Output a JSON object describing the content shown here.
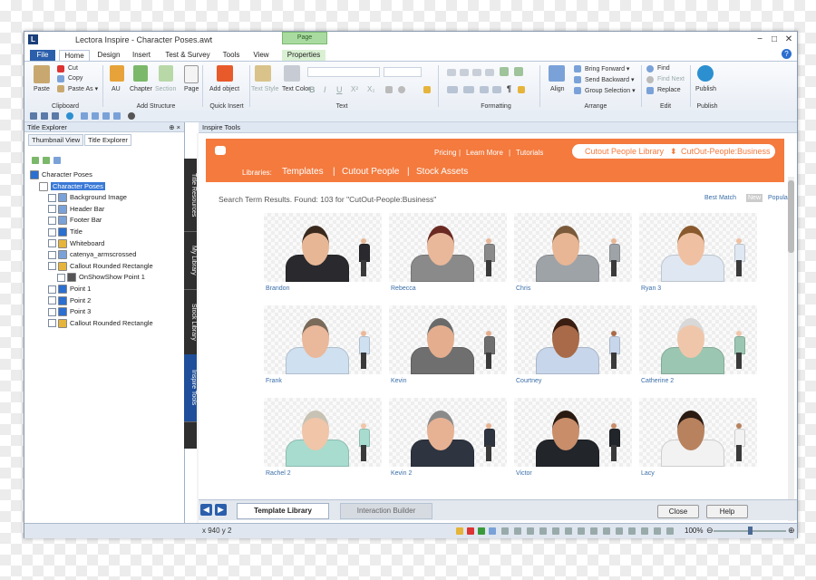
{
  "title_bar": {
    "app_logo": "L",
    "title": "Lectora Inspire - Character Poses.awt",
    "context_tab_header": "Page"
  },
  "window_controls": {
    "minimize": "−",
    "maximize": "□",
    "close": "✕"
  },
  "ribbon_tabs": [
    "File",
    "Home",
    "Design",
    "Insert",
    "Test & Survey",
    "Tools",
    "View",
    "Properties"
  ],
  "help": "?",
  "ribbon": {
    "clipboard": {
      "paste": "Paste",
      "cut": "Cut",
      "copy": "Copy",
      "paste_as": "Paste As ▾",
      "label": "Clipboard"
    },
    "add_structure": {
      "au": "AU",
      "chapter": "Chapter",
      "section": "Section",
      "page": "Page",
      "label": "Add Structure"
    },
    "quick_insert": {
      "add_object": "Add object",
      "label": "Quick Insert"
    },
    "text": {
      "text_style": "Text Style",
      "text_color": "Text Color",
      "bold": "B",
      "italic": "I",
      "underline": "U",
      "superscript": "X²",
      "subscript": "X₂",
      "label": "Text"
    },
    "formatting": {
      "pilcrow": "¶",
      "label": "Formatting"
    },
    "arrange": {
      "align": "Align",
      "bring_forward": "Bring Forward ▾",
      "send_backward": "Send Backward ▾",
      "group_selection": "Group Selection ▾",
      "label": "Arrange"
    },
    "edit": {
      "find": "Find",
      "find_next": "Find Next",
      "replace": "Replace",
      "label": "Edit"
    },
    "publish": {
      "publish": "Publish",
      "label": "Publish"
    }
  },
  "left_panel": {
    "header": "Title Explorer",
    "pin": "⊕ ×",
    "tabs": [
      "Thumbnail View",
      "Title Explorer"
    ],
    "tree": [
      {
        "label": "Character Poses",
        "indent": 0,
        "color": "#2b6fd0"
      },
      {
        "label": "Character Poses",
        "indent": 1,
        "color": "#ffffff",
        "selected": true
      },
      {
        "label": "Background Image",
        "indent": 2,
        "color": "#7aa2d8"
      },
      {
        "label": "Header Bar",
        "indent": 2,
        "color": "#7aa2d8"
      },
      {
        "label": "Footer Bar",
        "indent": 2,
        "color": "#7aa2d8"
      },
      {
        "label": "Title",
        "indent": 2,
        "color": "#2b6fd0"
      },
      {
        "label": "Whiteboard",
        "indent": 2,
        "color": "#e6b43a"
      },
      {
        "label": "catenya_armscrossed",
        "indent": 2,
        "color": "#7aa2d8"
      },
      {
        "label": "Callout Rounded Rectangle",
        "indent": 2,
        "color": "#e6b43a"
      },
      {
        "label": "OnShowShow Point 1",
        "indent": 3,
        "color": "#555555"
      },
      {
        "label": "Point 1",
        "indent": 2,
        "color": "#2b6fd0"
      },
      {
        "label": "Point 2",
        "indent": 2,
        "color": "#2b6fd0"
      },
      {
        "label": "Point 3",
        "indent": 2,
        "color": "#2b6fd0"
      },
      {
        "label": "Callout Rounded Rectangle",
        "indent": 2,
        "color": "#e6b43a"
      }
    ]
  },
  "vertical_tabs": [
    "Title Resources",
    "My Library",
    "Stock Library",
    "Inspire Tools"
  ],
  "main": {
    "header": "Inspire Tools",
    "top_links": [
      "Pricing",
      "Learn More",
      "Tutorials"
    ],
    "separator": "|",
    "selector_left": "Cutout People Library",
    "selector_arrow": "⬍",
    "selector_right": "CutOut-People:Business",
    "libraries_label": "Libraries:",
    "libraries": [
      "Templates",
      "Cutout People",
      "Stock Assets"
    ],
    "results": "Search Term Results. Found: 103 for \"CutOut-People:Business\"",
    "sort": [
      "Best Match",
      "New",
      "Popular"
    ],
    "people": [
      {
        "name": "Brandon",
        "skin": "#e7b795",
        "hair": "#3a2a1e",
        "suit": "#2a2a2e"
      },
      {
        "name": "Rebecca",
        "skin": "#e9b89a",
        "hair": "#6a2a22",
        "suit": "#8a8a8a"
      },
      {
        "name": "Chris",
        "skin": "#e8b694",
        "hair": "#7a5a3a",
        "suit": "#9ea3a8"
      },
      {
        "name": "Ryan 3",
        "skin": "#efc1a2",
        "hair": "#8a5a2e",
        "suit": "#dfe8f2"
      },
      {
        "name": "Frank",
        "skin": "#eab89a",
        "hair": "#7a6a5a",
        "suit": "#cfe0f0"
      },
      {
        "name": "Kevin",
        "skin": "#e4ae8e",
        "hair": "#6a6a6a",
        "suit": "#6f6f6f"
      },
      {
        "name": "Courtney",
        "skin": "#a86a48",
        "hair": "#3a1e12",
        "suit": "#c7d6ea"
      },
      {
        "name": "Catherine 2",
        "skin": "#f0c6aa",
        "hair": "#d8d8d8",
        "suit": "#9bc7b2"
      },
      {
        "name": "Rachel 2",
        "skin": "#f0c5a8",
        "hair": "#c8c2b4",
        "suit": "#a7dccf"
      },
      {
        "name": "Kevin 2",
        "skin": "#e7b293",
        "hair": "#8a8a8a",
        "suit": "#2e3440"
      },
      {
        "name": "Victor",
        "skin": "#c98d6a",
        "hair": "#2a1a12",
        "suit": "#22252a"
      },
      {
        "name": "Lacy",
        "skin": "#b8825f",
        "hair": "#2a1a12",
        "suit": "#f2f2f2"
      }
    ]
  },
  "bottom": {
    "nav_left": "◀",
    "nav_right": "▶",
    "tabs": [
      "Template Library",
      "Interaction Builder"
    ],
    "close": "Close",
    "help": "Help"
  },
  "status_bar": {
    "coords": "x 940  y 2",
    "zoom": "100%",
    "zoom_minus": "⊖",
    "zoom_plus": "⊕"
  }
}
